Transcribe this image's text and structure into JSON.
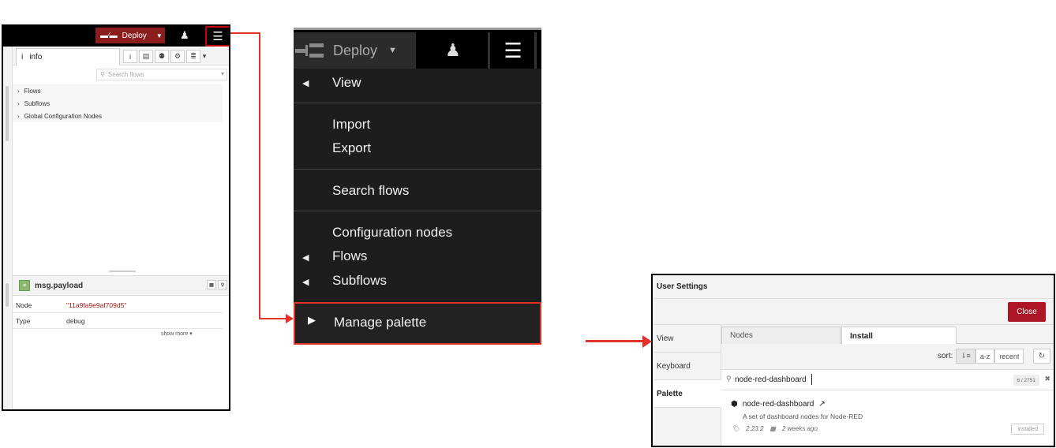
{
  "left_panel": {
    "header": {
      "deploy_label": "Deploy"
    },
    "sidebar_tab": {
      "icon": "i",
      "label": "info"
    },
    "tab_icons": [
      "i",
      "▤",
      "⚉",
      "⚙",
      "≣",
      "▾"
    ],
    "search_placeholder": "Search flows",
    "tree": [
      "Flows",
      "Subflows",
      "Global Configuration Nodes"
    ],
    "debug": {
      "title": "msg.payload",
      "rows": [
        {
          "key": "Node",
          "value": "\"11a9fa9e9af709d5\""
        },
        {
          "key": "Type",
          "value": "debug"
        }
      ],
      "show_more": "show more ▾"
    }
  },
  "menu_panel": {
    "deploy_label": "Deploy",
    "items": {
      "view": "View",
      "import": "Import",
      "export": "Export",
      "search_flows": "Search flows",
      "configuration_nodes": "Configuration nodes",
      "flows": "Flows",
      "subflows": "Subflows",
      "manage_palette": "Manage palette"
    }
  },
  "settings": {
    "title": "User Settings",
    "close_label": "Close",
    "sidebar": [
      "View",
      "Keyboard",
      "Palette"
    ],
    "tabs": [
      "Nodes",
      "Install"
    ],
    "sort_label": "sort:",
    "sort_options": [
      "a-z",
      "recent"
    ],
    "search_value": "node-red-dashboard",
    "result_count": "6 / 2751",
    "result": {
      "name": "node-red-dashboard",
      "description": "A set of dashboard nodes for Node-RED",
      "version": "2.23.2",
      "updated": "2 weeks ago",
      "status": "installed"
    }
  },
  "colors": {
    "annotation_red": "#e0342a",
    "deploy_red": "#8c1d1d",
    "close_button": "#ad1625"
  }
}
